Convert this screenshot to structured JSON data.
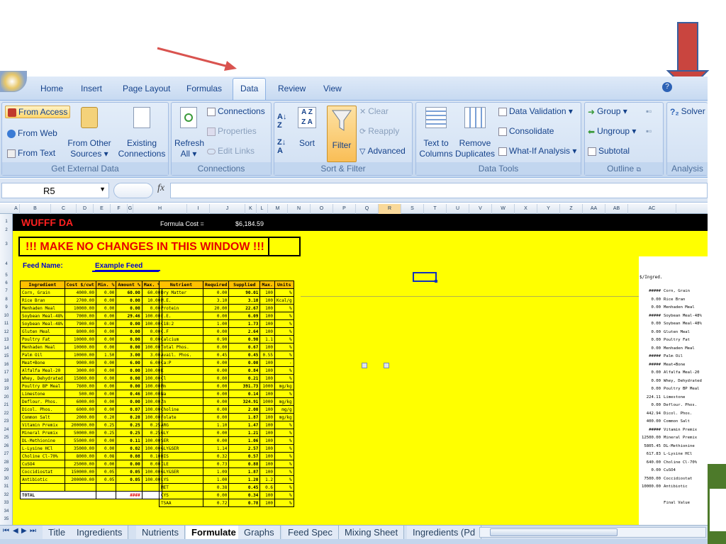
{
  "ribbon": {
    "tabs": [
      "Home",
      "Insert",
      "Page Layout",
      "Formulas",
      "Data",
      "Review",
      "View"
    ],
    "active_tab": "Data",
    "get_external": {
      "from_access": "From Access",
      "from_web": "From Web",
      "from_text": "From Text",
      "from_other_1": "From Other",
      "from_other_2": "Sources",
      "existing_1": "Existing",
      "existing_2": "Connections",
      "label": "Get External Data"
    },
    "connections": {
      "refresh_1": "Refresh",
      "refresh_2": "All",
      "connections": "Connections",
      "properties": "Properties",
      "edit_links": "Edit Links",
      "label": "Connections"
    },
    "sort_filter": {
      "sort": "Sort",
      "filter": "Filter",
      "clear": "Clear",
      "reapply": "Reapply",
      "advanced": "Advanced",
      "label": "Sort & Filter"
    },
    "data_tools": {
      "text_cols_1": "Text to",
      "text_cols_2": "Columns",
      "remove_dup_1": "Remove",
      "remove_dup_2": "Duplicates",
      "validation": "Data Validation",
      "consolidate": "Consolidate",
      "whatif": "What-If Analysis",
      "label": "Data Tools"
    },
    "outline": {
      "group": "Group",
      "ungroup": "Ungroup",
      "subtotal": "Subtotal",
      "label": "Outline"
    },
    "analysis": {
      "solver": "Solver",
      "label": "Analysis"
    }
  },
  "formula_bar": {
    "name_box": "R5",
    "fx": "fx",
    "value": ""
  },
  "columns": [
    "A",
    "B",
    "C",
    "D",
    "E",
    "F",
    "G",
    "H",
    "I",
    "J",
    "K",
    "L",
    "M",
    "N",
    "O",
    "P",
    "Q",
    "R",
    "S",
    "T",
    "U",
    "V",
    "W",
    "X",
    "Y",
    "Z",
    "AA",
    "AB",
    "AC"
  ],
  "active_column": "R",
  "rows": [
    "1",
    "2",
    "3",
    "4",
    "5",
    "6",
    "7",
    "8",
    "9",
    "10",
    "11",
    "12",
    "13",
    "14",
    "15",
    "16",
    "17",
    "18",
    "19",
    "20",
    "21",
    "22",
    "23",
    "24",
    "25",
    "26",
    "27",
    "28",
    "29",
    "30",
    "31",
    "32",
    "33",
    "34",
    "35"
  ],
  "sheet": {
    "title": "WUFFF DA",
    "formula_cost_label": "Formula Cost =",
    "formula_cost": "$6,184.59",
    "warning": "!!! MAKE NO CHANGES IN THIS WINDOW !!!",
    "feed_label": "Feed Name:",
    "feed_name": "Example Feed",
    "ing_headers": [
      "Ingredient",
      "Cost\n$/cwt",
      "Min.\n%",
      "Amount\n%",
      "Max.\n%"
    ],
    "ingredients": [
      [
        "Corn, Grain",
        "4000.00",
        "0.00",
        "60.00",
        "60.00"
      ],
      [
        "Rice Bran",
        "2700.00",
        "0.00",
        "0.00",
        "10.00"
      ],
      [
        "Menhaden Meal",
        "10000.00",
        "0.00",
        "0.00",
        "0.00"
      ],
      [
        "Soybean Meal-48%",
        "7000.00",
        "0.00",
        "29.46",
        "100.00"
      ],
      [
        "Soybean Meal-48%",
        "7900.00",
        "0.00",
        "0.00",
        "100.00"
      ],
      [
        "Gluten Meal",
        "8000.00",
        "0.00",
        "0.00",
        "0.00"
      ],
      [
        "Poultry Fat",
        "10000.00",
        "0.00",
        "0.00",
        "0.00"
      ],
      [
        "Menhaden Meal",
        "10000.00",
        "0.00",
        "0.00",
        "100.00"
      ],
      [
        "Palm Oil",
        "10000.00",
        "1.50",
        "3.00",
        "3.00"
      ],
      [
        "Meat+Bone",
        "9000.00",
        "0.00",
        "6.00",
        "6.00"
      ],
      [
        "Alfalfa Meal-20",
        "3000.00",
        "0.00",
        "0.00",
        "100.00"
      ],
      [
        "Whey, Dehydrated",
        "15000.00",
        "0.00",
        "0.00",
        "100.00"
      ],
      [
        "Poultry BP Meal",
        "7600.00",
        "0.00",
        "0.00",
        "100.00"
      ],
      [
        "Limestone",
        "500.00",
        "0.00",
        "0.46",
        "100.00"
      ],
      [
        "Deflour. Phos.",
        "6000.00",
        "0.00",
        "0.00",
        "100.00"
      ],
      [
        "Dicol. Phos.",
        "6000.00",
        "0.00",
        "0.07",
        "100.00"
      ],
      [
        "Common Salt",
        "2000.00",
        "0.20",
        "0.20",
        "100.00"
      ],
      [
        "Vitamin Premix",
        "200000.00",
        "0.25",
        "0.25",
        "0.25"
      ],
      [
        "Mineral Premix",
        "50000.00",
        "0.25",
        "0.25",
        "0.25"
      ],
      [
        "DL-Methionine",
        "55000.00",
        "0.00",
        "0.11",
        "100.00"
      ],
      [
        "L-Lysine HCl",
        "35000.00",
        "0.00",
        "0.02",
        "100.00"
      ],
      [
        "Choline Cl-70%",
        "8000.00",
        "0.08",
        "0.08",
        "0.10"
      ],
      [
        "CuSO4",
        "25000.00",
        "0.00",
        "0.00",
        "0.00"
      ],
      [
        "Coccidiostat",
        "150000.00",
        "0.05",
        "0.05",
        "100.00"
      ],
      [
        "Antibiotic",
        "200000.00",
        "0.05",
        "0.05",
        "100.00"
      ]
    ],
    "total_label": "TOTAL",
    "total_value": "####",
    "nut_headers": [
      "Nutrient",
      "Required",
      "Supplied",
      "Max.",
      "Units"
    ],
    "nutrients": [
      [
        "Dry Matter",
        "0.00",
        "90.01",
        "100",
        "%"
      ],
      [
        "M.E.",
        "3.10",
        "3.10",
        "100",
        "Kcal/g"
      ],
      [
        "Protein",
        "20.00",
        "22.67",
        "100",
        "%"
      ],
      [
        "E.E.",
        "0.00",
        "6.09",
        "100",
        "%"
      ],
      [
        "C18:2",
        "1.00",
        "1.73",
        "100",
        "%"
      ],
      [
        "C.F",
        "0.00",
        "2.64",
        "100",
        "%"
      ],
      [
        "Calcium",
        "0.90",
        "0.90",
        "1.1",
        "%"
      ],
      [
        "Total Phos.",
        "0.00",
        "0.67",
        "100",
        "%"
      ],
      [
        "Avail. Phos.",
        "0.45",
        "0.45",
        "0.55",
        "%"
      ],
      [
        "Ca:P",
        "0.00",
        "0.00",
        "100",
        "-"
      ],
      [
        "K",
        "0.00",
        "0.84",
        "100",
        "%"
      ],
      [
        "Cl",
        "0.00",
        "0.21",
        "100",
        "%"
      ],
      [
        "Mn",
        "0.00",
        "391.73",
        "1000",
        "mg/kg"
      ],
      [
        "Na",
        "0.00",
        "0.14",
        "100",
        "%"
      ],
      [
        "Zn",
        "0.00",
        "324.91",
        "1000",
        "mg/kg"
      ],
      [
        "Choline",
        "0.00",
        "2.00",
        "100",
        "mg/g"
      ],
      [
        "Folate",
        "0.00",
        "1.87",
        "100",
        "mg/kg"
      ],
      [
        "ARG",
        "1.10",
        "1.47",
        "100",
        "%"
      ],
      [
        "GLY",
        "0.00",
        "1.21",
        "100",
        "%"
      ],
      [
        "SER",
        "0.00",
        "1.06",
        "100",
        "%"
      ],
      [
        "GLY&SER",
        "1.14",
        "2.57",
        "100",
        "%"
      ],
      [
        "HIS",
        "0.32",
        "0.57",
        "100",
        "%"
      ],
      [
        "ILE",
        "0.73",
        "0.88",
        "100",
        "%"
      ],
      [
        "GLY&SER",
        "1.09",
        "1.87",
        "100",
        "%"
      ],
      [
        "LYS",
        "1.00",
        "1.20",
        "1.2",
        "%"
      ],
      [
        "MET",
        "0.38",
        "0.45",
        "0.6",
        "%"
      ],
      [
        "CYS",
        "0.00",
        "0.34",
        "100",
        "%"
      ],
      [
        "TSAA",
        "0.72",
        "0.78",
        "100",
        "%"
      ]
    ],
    "right_header": "$/Ingred.",
    "right_rows": [
      [
        "#####",
        "Corn, Grain"
      ],
      [
        "0.00",
        "Rice Bran"
      ],
      [
        "0.00",
        "Menhaden Meal"
      ],
      [
        "#####",
        "Soybean Meal-48%"
      ],
      [
        "0.00",
        "Soybean Meal-48%"
      ],
      [
        "0.00",
        "Gluten Meal"
      ],
      [
        "0.00",
        "Poultry Fat"
      ],
      [
        "0.00",
        "Menhaden Meal"
      ],
      [
        "#####",
        "Palm Oil"
      ],
      [
        "#####",
        "Meat+Bone"
      ],
      [
        "0.00",
        "Alfalfa Meal-20"
      ],
      [
        "0.00",
        "Whey, Dehydrated"
      ],
      [
        "0.00",
        "Poultry BP Meal"
      ],
      [
        "224.11",
        "Limestone"
      ],
      [
        "0.00",
        "Deflour. Phos."
      ],
      [
        "442.94",
        "Dicol. Phos."
      ],
      [
        "400.00",
        "Common Salt"
      ],
      [
        "#####",
        "Vitamin Premix"
      ],
      [
        "12500.00",
        "Mineral Premix"
      ],
      [
        "5805.45",
        "DL-Methionine"
      ],
      [
        "617.83",
        "L-Lysine HCl"
      ],
      [
        "640.00",
        "Choline Cl-70%"
      ],
      [
        "0.00",
        "CuSO4"
      ],
      [
        "7500.00",
        "Coccidiostat"
      ],
      [
        "10000.00",
        "Antibiotic"
      ],
      [
        "",
        ""
      ],
      [
        "",
        "Final Value"
      ]
    ]
  },
  "sheet_tabs": [
    "Title",
    "Ingredients",
    "Nutrients",
    "Formulate",
    "Graphs",
    "Feed Spec",
    "Mixing Sheet",
    "Ingredients (Pd"
  ],
  "active_sheet": "Formulate",
  "colors": {
    "sheet_bg": "#ffff00",
    "header_fill": "#ffc000",
    "warning": "#e60000",
    "title": "#ff2020",
    "annotation_arrow": "#d9534f"
  }
}
